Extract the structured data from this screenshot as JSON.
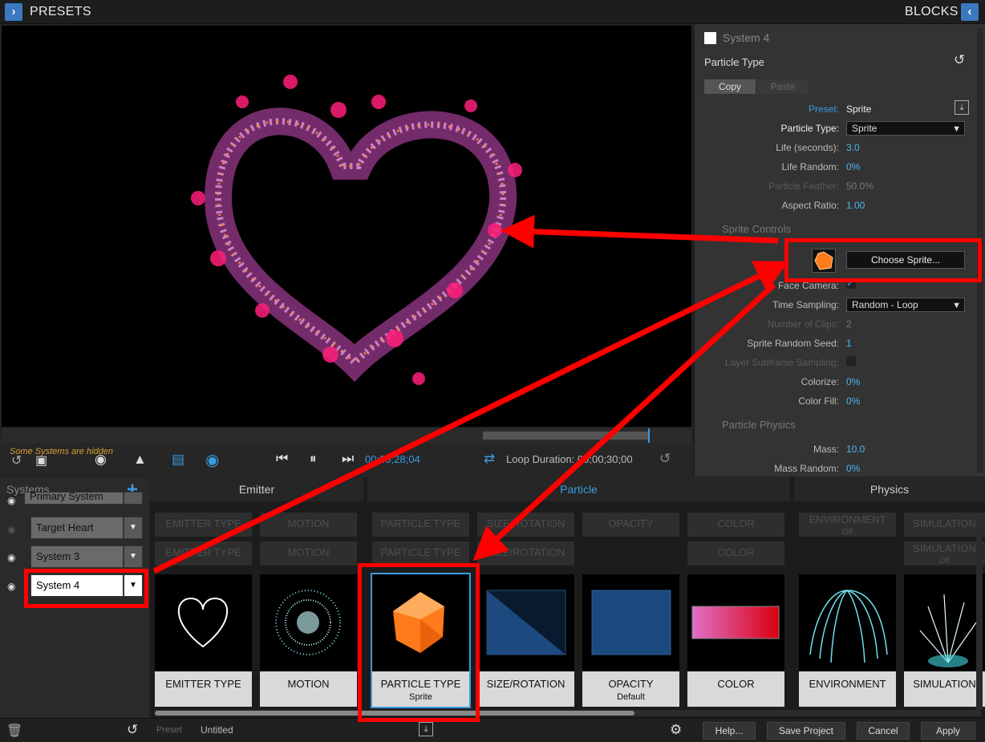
{
  "topbar": {
    "left_title": "PRESETS",
    "right_title": "BLOCKS"
  },
  "transport": {
    "hidden_notice": "Some Systems are hidden",
    "timecode": "00;00;28;04",
    "loop_label": "Loop Duration: 00;00;30;00"
  },
  "inspector": {
    "system_name": "System 4",
    "block_title": "Particle Type",
    "copy_label": "Copy",
    "paste_label": "Paste",
    "preset_label": "Preset:",
    "preset_value": "Sprite",
    "particle_type_label": "Particle Type:",
    "particle_type_value": "Sprite",
    "life_label": "Life (seconds):",
    "life_value": "3.0",
    "life_random_label": "Life Random:",
    "life_random_value": "0%",
    "feather_label": "Particle Feather:",
    "feather_value": "50.0%",
    "aspect_label": "Aspect Ratio:",
    "aspect_value": "1.00",
    "sprite_controls_heading": "Sprite Controls",
    "choose_sprite_label": "Choose Sprite...",
    "face_camera_label": "Face Camera:",
    "time_sampling_label": "Time Sampling:",
    "time_sampling_value": "Random - Loop",
    "clips_label": "Number of Clips:",
    "clips_value": "2",
    "seed_label": "Sprite Random Seed:",
    "seed_value": "1",
    "subframe_label": "Layer Subframe Sampling:",
    "colorize_label": "Colorize:",
    "colorize_value": "0%",
    "colorfill_label": "Color Fill:",
    "colorfill_value": "0%",
    "physics_heading": "Particle Physics",
    "mass_label": "Mass:",
    "mass_value": "10.0",
    "mass_random_label": "Mass Random:",
    "mass_random_value": "0%"
  },
  "systems": {
    "header": "Systems",
    "items": [
      "Primary System",
      "Target Heart",
      "System 3",
      "System 4"
    ]
  },
  "blocks": {
    "headers": {
      "emitter": "Emitter",
      "particle": "Particle",
      "physics": "Physics"
    },
    "ghost": {
      "emitter_type": "EMITTER TYPE",
      "motion": "MOTION",
      "particle_type": "PARTICLE TYPE",
      "size_rotation": "SIZE/ROTATION",
      "opacity": "OPACITY",
      "color": "COLOR",
      "environment": "ENVIRONMENT",
      "env_sub": "Off",
      "simulation": "SIMULATION",
      "sim_sub": "Off"
    },
    "cards": {
      "emitter_type": "EMITTER TYPE",
      "motion": "MOTION",
      "particle_type": "PARTICLE TYPE",
      "particle_type_sub": "Sprite",
      "size_rotation": "SIZE/ROTATION",
      "opacity": "OPACITY",
      "opacity_sub": "Default",
      "color": "COLOR",
      "environment": "ENVIRONMENT",
      "simulation": "SIMULATION"
    }
  },
  "bottombar": {
    "preset_label": "Preset",
    "preset_value": "Untitled",
    "help": "Help...",
    "save": "Save Project",
    "cancel": "Cancel",
    "apply": "Apply"
  },
  "colors": {
    "accent": "#3a9be0",
    "highlight": "#ff0000",
    "sprite_orange": "#ff7a1a"
  }
}
